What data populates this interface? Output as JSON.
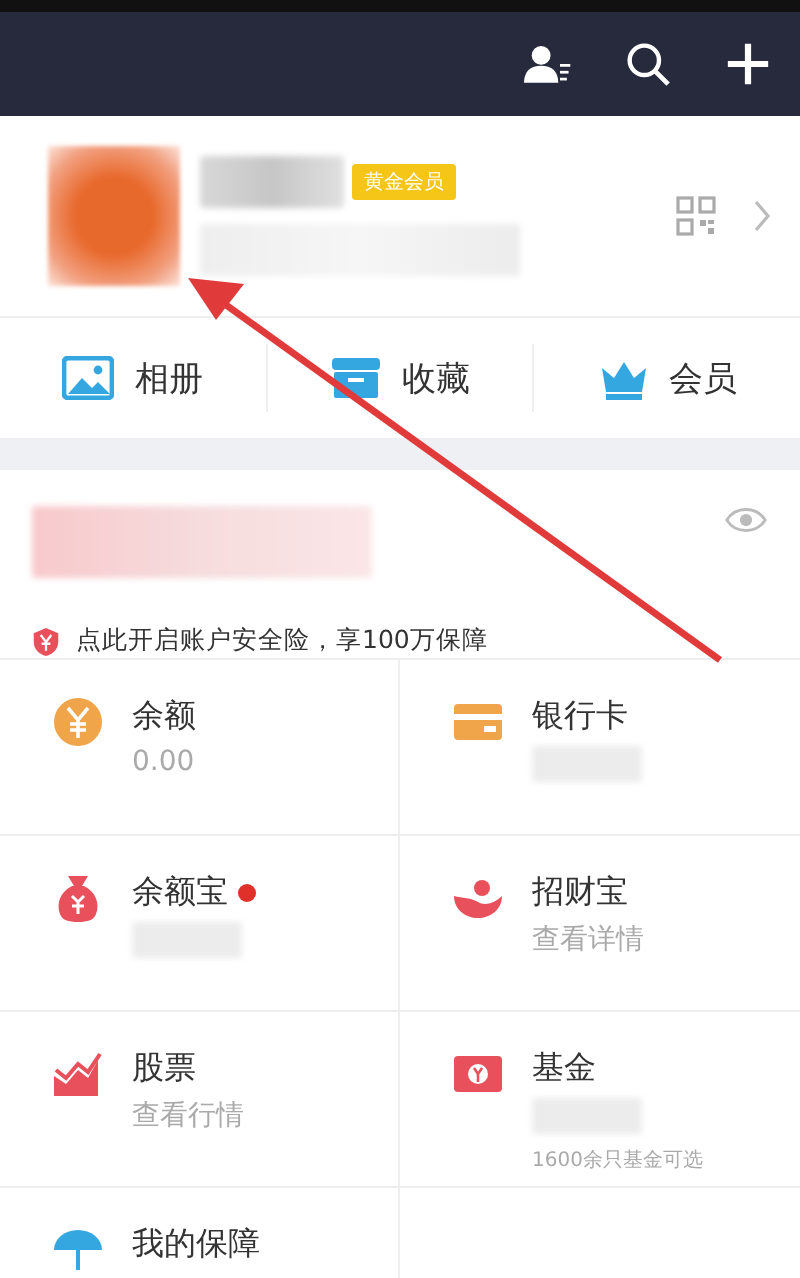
{
  "header": {
    "actions": [
      {
        "kind": "contacts"
      },
      {
        "kind": "search"
      },
      {
        "kind": "add"
      }
    ]
  },
  "profile": {
    "badge": "黄金会员",
    "masked": true
  },
  "shortcuts": [
    {
      "label": "相册",
      "kind": "album"
    },
    {
      "label": "收藏",
      "kind": "favorites"
    },
    {
      "label": "会员",
      "kind": "member"
    }
  ],
  "balance_card": {
    "masked": true,
    "notice": "点此开启账户安全险，享100万保障"
  },
  "assets": [
    {
      "title": "余额",
      "subtitle": "0.00",
      "masked": false,
      "dot": false,
      "kind": "coin"
    },
    {
      "title": "银行卡",
      "masked": true,
      "dot": false,
      "kind": "card"
    },
    {
      "title": "余额宝",
      "masked": true,
      "dot": true,
      "kind": "bag"
    },
    {
      "title": "招财宝",
      "subtitle": "查看详情",
      "masked": false,
      "dot": false,
      "kind": "bowl"
    },
    {
      "title": "股票",
      "subtitle": "查看行情",
      "masked": false,
      "dot": false,
      "kind": "stock"
    },
    {
      "title": "基金",
      "masked": true,
      "note": "1600余只基金可选",
      "dot": false,
      "kind": "fund"
    },
    {
      "title": "我的保障",
      "masked": false,
      "dot": false,
      "kind": "umbrella"
    },
    {
      "kind": "empty"
    }
  ]
}
